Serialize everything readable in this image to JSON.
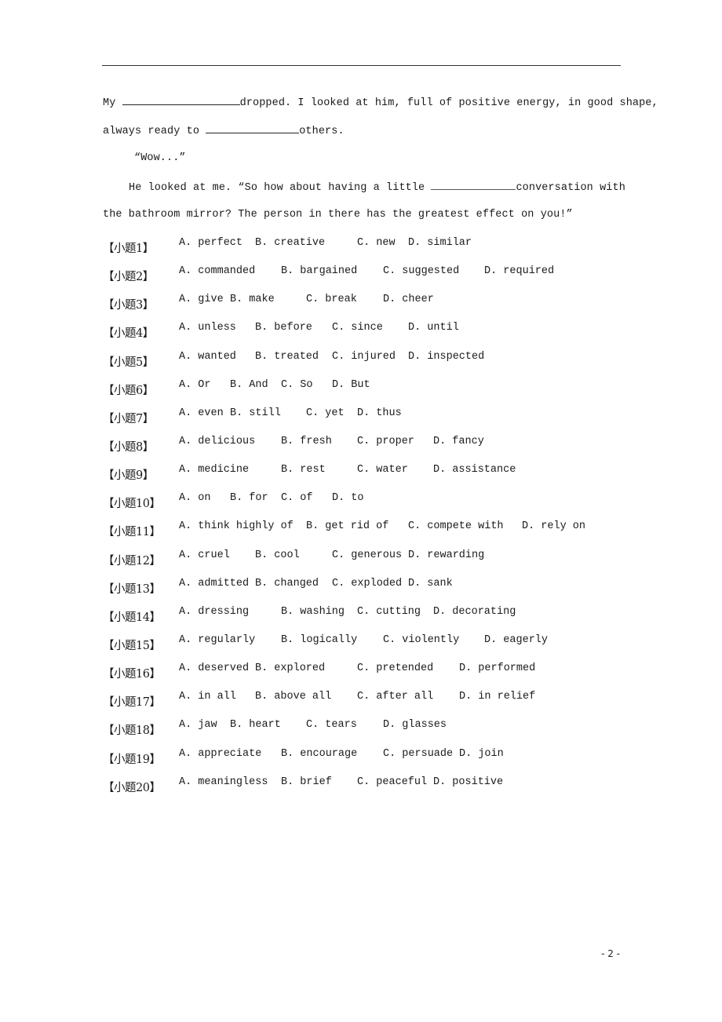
{
  "passage": {
    "line1_before": "My ",
    "line1_after": "dropped. I looked at him, full of positive energy, in good shape,",
    "line2_before": "always ready to ",
    "line2_after": "others.",
    "line3": "“Wow...”",
    "line4_before": "He looked at me. “So how about having a little ",
    "line4_after": "conversation with",
    "line5": "the bathroom mirror? The person in there has the greatest effect on you!”"
  },
  "questions": [
    {
      "label": "【小题1】",
      "options": [
        "A. perfect",
        "B. creative",
        "C. new",
        "D. similar"
      ]
    },
    {
      "label": "【小题2】",
      "options": [
        "A. commanded",
        "B. bargained",
        "C. suggested",
        "D. required"
      ]
    },
    {
      "label": "【小题3】",
      "options": [
        "A. give",
        "B. make",
        "C. break",
        "D. cheer"
      ]
    },
    {
      "label": "【小题4】",
      "options": [
        "A. unless",
        "B. before",
        "C. since",
        "D. until"
      ]
    },
    {
      "label": "【小题5】",
      "options": [
        "A. wanted",
        "B. treated",
        "C. injured",
        "D. inspected"
      ]
    },
    {
      "label": "【小题6】",
      "options": [
        "A. Or",
        "B. And",
        "C. So",
        "D. But"
      ]
    },
    {
      "label": "【小题7】",
      "options": [
        "A. even",
        "B. still",
        "C. yet",
        "D. thus"
      ]
    },
    {
      "label": "【小题8】",
      "options": [
        "A. delicious",
        "B. fresh",
        "C. proper",
        "D. fancy"
      ]
    },
    {
      "label": "【小题9】",
      "options": [
        "A. medicine",
        "B. rest",
        "C. water",
        "D. assistance"
      ]
    },
    {
      "label": "【小题10】",
      "options": [
        "A. on",
        "B. for",
        "C. of",
        "D. to"
      ]
    },
    {
      "label": "【小题11】",
      "options": [
        "A. think highly of",
        "B. get rid of",
        "C. compete with",
        "D. rely on"
      ]
    },
    {
      "label": "【小题12】",
      "options": [
        "A. cruel",
        "B. cool",
        "C. generous",
        "D. rewarding"
      ]
    },
    {
      "label": "【小题13】",
      "options": [
        "A. admitted",
        "B. changed",
        "C. exploded",
        "D. sank"
      ]
    },
    {
      "label": "【小题14】",
      "options": [
        "A. dressing",
        "B. washing",
        "C. cutting",
        "D. decorating"
      ]
    },
    {
      "label": "【小题15】",
      "options": [
        "A. regularly",
        "B. logically",
        "C. violently",
        "D. eagerly"
      ]
    },
    {
      "label": "【小题16】",
      "options": [
        "A. deserved",
        "B. explored",
        "C. pretended",
        "D. performed"
      ]
    },
    {
      "label": "【小题17】",
      "options": [
        "A. in all",
        "B. above all",
        "C. after all",
        "D. in relief"
      ]
    },
    {
      "label": "【小题18】",
      "options": [
        "A. jaw",
        "B. heart",
        "C. tears",
        "D. glasses"
      ]
    },
    {
      "label": "【小题19】",
      "options": [
        "A. appreciate",
        "B. encourage",
        "C. persuade",
        "D. join"
      ]
    },
    {
      "label": "【小题20】",
      "options": [
        "A. meaningless",
        "B. brief",
        "C. peaceful",
        "D. positive"
      ]
    }
  ],
  "footer": {
    "page_number": "- 2 -"
  }
}
